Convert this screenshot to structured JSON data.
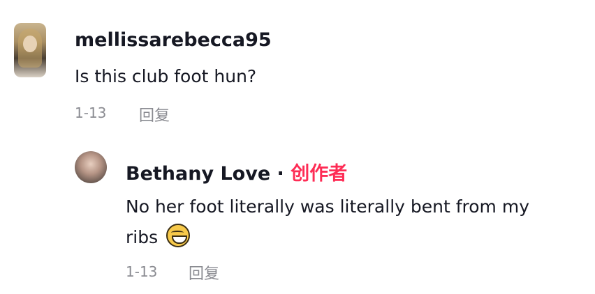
{
  "comments": [
    {
      "username": "mellissarebecca95",
      "text": "Is this club foot hun?",
      "date": "1-13",
      "reply_label": "回复"
    },
    {
      "username": "Bethany Love",
      "separator": "·",
      "creator_badge": "创作者",
      "text_line1": "No her foot literally was literally bent from my",
      "text_line2": "ribs",
      "emoji_icon": "laughing-tears-emoji-icon",
      "date": "1-13",
      "reply_label": "回复"
    }
  ],
  "colors": {
    "text": "#161823",
    "muted": "#8a8b91",
    "creator_accent": "#fe2c55",
    "background": "#ffffff"
  }
}
